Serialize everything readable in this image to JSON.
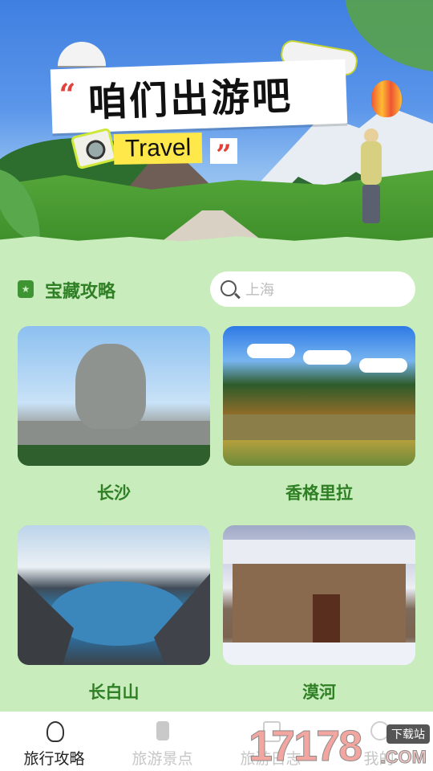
{
  "banner": {
    "title": "咱们出游吧",
    "subtitle": "Travel",
    "quote_open": "“",
    "quote_close": "”"
  },
  "section": {
    "icon": "bookmark-star-icon",
    "title": "宝藏攻略"
  },
  "search": {
    "placeholder": "上海",
    "icon": "search-icon"
  },
  "destinations": [
    {
      "name": "长沙"
    },
    {
      "name": "香格里拉"
    },
    {
      "name": "长白山"
    },
    {
      "name": "漠河"
    }
  ],
  "tabs": [
    {
      "label": "旅行攻略",
      "icon": "lightbulb-icon",
      "active": true
    },
    {
      "label": "旅游景点",
      "icon": "luggage-icon",
      "active": false
    },
    {
      "label": "旅游日志",
      "icon": "notebook-icon",
      "active": false
    },
    {
      "label": "我的",
      "icon": "user-icon",
      "active": false
    }
  ],
  "watermark": {
    "number": "17178",
    "download": "下载站",
    "domain": ".COM"
  },
  "colors": {
    "page_bg": "#c9ecbd",
    "accent_green": "#2f7f24",
    "title_yellow": "#ffe84a",
    "quote_red": "#e2423a"
  }
}
